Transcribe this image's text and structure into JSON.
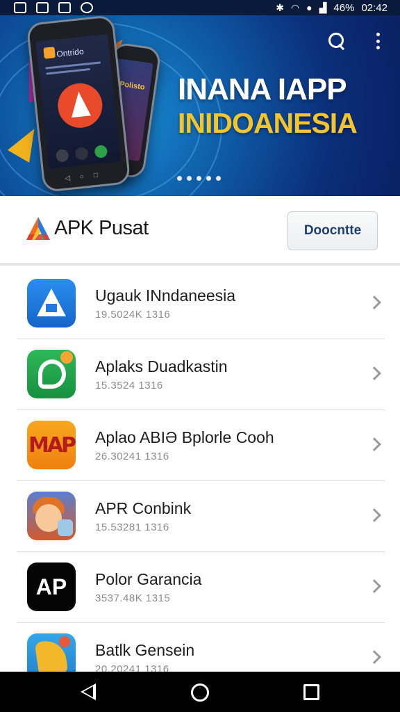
{
  "status_bar": {
    "battery": "46%",
    "time": "02:42",
    "left_icons": [
      "notification-icon",
      "image-icon",
      "tiktok-icon",
      "settings-icon"
    ],
    "right_icons": [
      "bluetooth-icon",
      "wifi-icon",
      "android-icon",
      "signal-icon"
    ]
  },
  "banner": {
    "title_line1": "INANA IAPP",
    "title_line2": "INIDOANESIA",
    "phone_screen_title": "Ontrido",
    "phone_back_text": "Polisto",
    "slides": 5,
    "active_slide": 1,
    "colors": {
      "title_line1": "#ffffff",
      "title_line2": "#f2c42e",
      "background": "#0f5da8"
    }
  },
  "header": {
    "brand_name": "APK Pusat",
    "button_label": "Doocntte"
  },
  "apps": [
    {
      "name": "Ugauk INndaneesia",
      "meta": "19.5024K 1316",
      "icon": "a-logo-icon"
    },
    {
      "name": "Aplaks Duadkastin",
      "meta": "15.3524 1316",
      "icon": "green-chat-icon"
    },
    {
      "name": "Aplao ABIƏ Bplorle Cooh",
      "meta": "26.30241 1316",
      "icon": "map-icon"
    },
    {
      "name": "APR Conbink",
      "meta": "15.53281 1316",
      "icon": "cartoon-character-icon"
    },
    {
      "name": "Polor Garancia",
      "meta": "3537.48K 1315",
      "icon": "ap-logo-icon"
    },
    {
      "name": "Batlk Gensein",
      "meta": "20.20241 1316",
      "icon": "game-character-icon"
    }
  ],
  "nav_bar": {
    "icons": [
      "back-icon",
      "home-icon",
      "recent-apps-icon"
    ]
  }
}
